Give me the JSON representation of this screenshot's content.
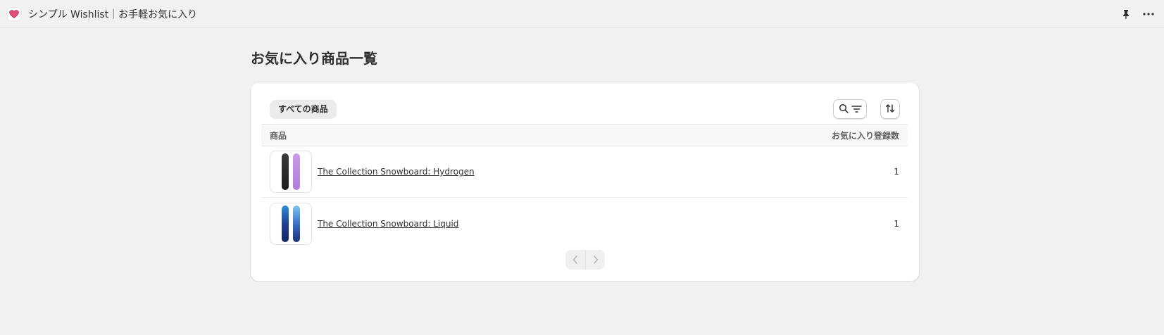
{
  "app": {
    "title": "シンプル Wishlist｜お手軽お気に入り",
    "icon": "heart-icon",
    "accent": "#e0527a"
  },
  "page": {
    "title": "お気に入り商品一覧"
  },
  "toolbar": {
    "tab_all_label": "すべての商品",
    "search_filter_icon": "search-filter-icon",
    "sort_icon": "sort-icon"
  },
  "table": {
    "columns": [
      "商品",
      "お気に入り登録数"
    ],
    "rows": [
      {
        "product": "The Collection Snowboard: Hydrogen",
        "count": "1",
        "thumb": "snowboard-hydrogen"
      },
      {
        "product": "The Collection Snowboard: Liquid",
        "count": "1",
        "thumb": "snowboard-liquid"
      }
    ]
  },
  "pagination": {
    "prev_icon": "chevron-left-icon",
    "next_icon": "chevron-right-icon"
  }
}
